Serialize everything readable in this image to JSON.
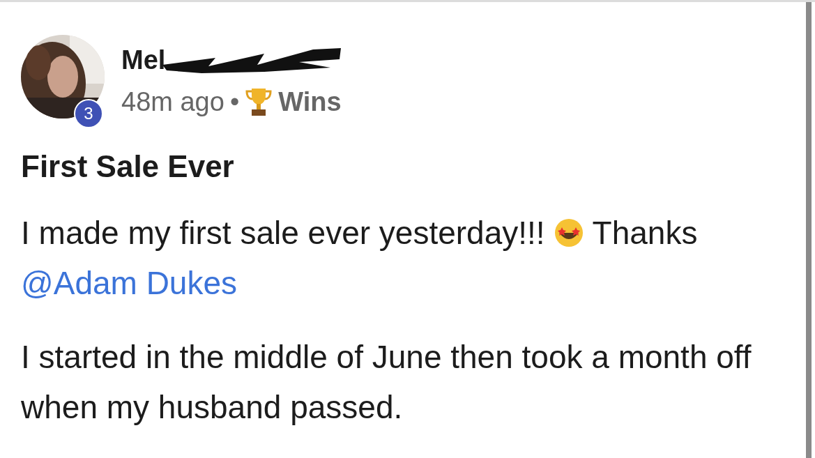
{
  "post": {
    "author": {
      "name_visible": "Mel",
      "redacted": true,
      "level_badge": "3"
    },
    "time": "48m ago",
    "separator": "•",
    "category": "Wins",
    "title": "First Sale Ever",
    "paragraphs": [
      {
        "parts": [
          {
            "kind": "text",
            "text": "I made my first sale ever yesterday!!!"
          },
          {
            "kind": "emoji"
          },
          {
            "kind": "text",
            "text": "Thanks"
          },
          {
            "kind": "mention",
            "text": "@Adam Dukes"
          }
        ]
      },
      {
        "parts": [
          {
            "kind": "text",
            "text": "I started in the middle of June then took a month off when my husband passed."
          }
        ]
      }
    ]
  }
}
